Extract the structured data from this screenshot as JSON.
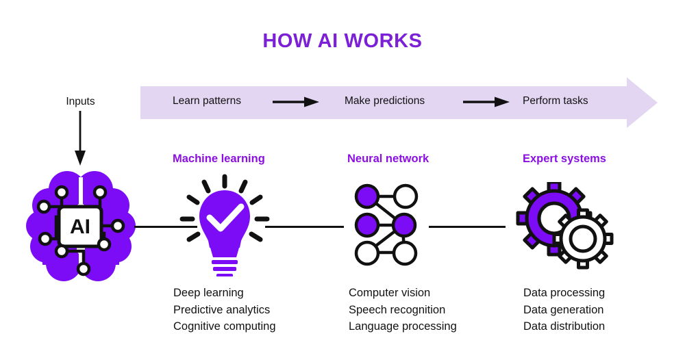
{
  "title": "HOW AI WORKS",
  "colors": {
    "title_purple": "#7B20D6",
    "heading_purple": "#8A0FE0",
    "icon_purple": "#7B0CF5",
    "banner_lavender": "#E3D6F2",
    "ink": "#111111"
  },
  "inputs": {
    "label": "Inputs"
  },
  "banner": {
    "steps": [
      {
        "label": "Learn patterns"
      },
      {
        "label": "Make predictions"
      },
      {
        "label": "Perform tasks"
      }
    ],
    "arrow_icons": [
      "arrow-right-icon",
      "arrow-right-icon"
    ]
  },
  "columns": [
    {
      "heading": "Machine learning",
      "icon": "lightbulb-check-icon",
      "items": [
        "Deep learning",
        "Predictive analytics",
        "Cognitive computing"
      ]
    },
    {
      "heading": "Neural network",
      "icon": "neural-network-icon",
      "items": [
        "Computer vision",
        "Speech recognition",
        "Language processing"
      ]
    },
    {
      "heading": "Expert systems",
      "icon": "gears-icon",
      "items": [
        "Data processing",
        "Data generation",
        "Data distribution"
      ]
    }
  ],
  "brain": {
    "icon": "brain-chip-icon",
    "chip_label": "AI"
  }
}
